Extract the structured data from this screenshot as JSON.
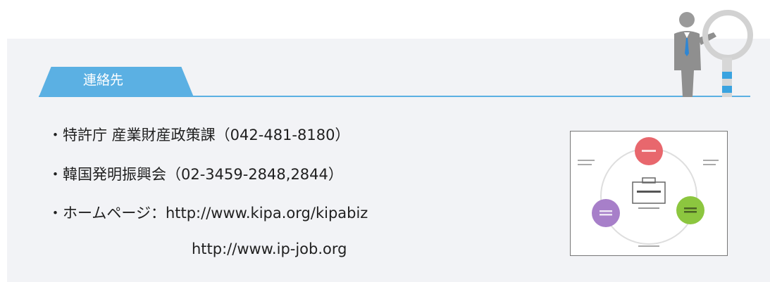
{
  "section": {
    "tab_label": "連絡先"
  },
  "contacts": {
    "line1": "・特許庁 産業財産政策課（042-481-8180）",
    "line2": "・韓国発明振興会（02-3459-2848,2844）",
    "line3": "・ホームページ：http://www.kipa.org/kipabiz",
    "line4": "http://www.ip-job.org"
  },
  "colors": {
    "accent": "#5bb0e3",
    "panel_bg": "#f2f3f6",
    "node_red": "#e8676d",
    "node_green": "#8cc63f",
    "node_purple": "#a77fc9"
  },
  "icons": {
    "figure": "person-with-magnifier-icon",
    "thumbnail": "cycle-diagram-thumbnail"
  }
}
